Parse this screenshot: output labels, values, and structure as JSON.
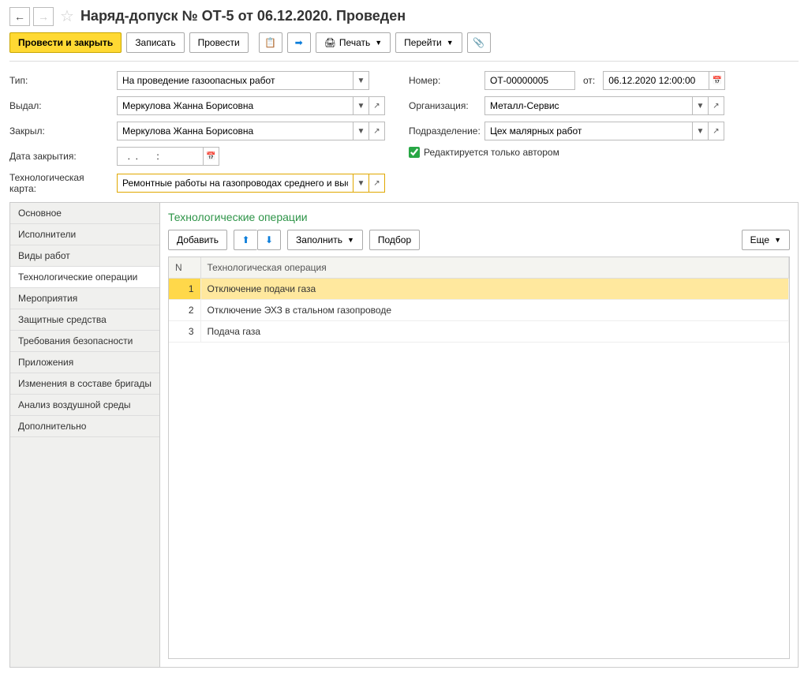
{
  "header": {
    "title": "Наряд-допуск № ОТ-5 от 06.12.2020. Проведен"
  },
  "toolbar": {
    "post_and_close": "Провести и закрыть",
    "save": "Записать",
    "post": "Провести",
    "print": "Печать",
    "goto": "Перейти"
  },
  "form": {
    "type_label": "Тип:",
    "type_value": "На проведение газоопасных работ",
    "issued_label": "Выдал:",
    "issued_value": "Меркулова Жанна Борисовна",
    "closed_label": "Закрыл:",
    "closed_value": "Меркулова Жанна Борисовна",
    "close_date_label": "Дата закрытия:",
    "close_date_value": "  .  .       :   ",
    "tech_card_label": "Технологическая карта:",
    "tech_card_value": "Ремонтные работы на газопроводах среднего и высокого да",
    "number_label": "Номер:",
    "number_value": "ОТ-00000005",
    "date_label": "от:",
    "date_value": "06.12.2020 12:00:00",
    "org_label": "Организация:",
    "org_value": "Металл-Сервис",
    "dept_label": "Подразделение:",
    "dept_value": "Цех малярных работ",
    "editable_label": "Редактируется только автором"
  },
  "sidebar": {
    "items": [
      {
        "label": "Основное"
      },
      {
        "label": "Исполнители"
      },
      {
        "label": "Виды работ"
      },
      {
        "label": "Технологические операции"
      },
      {
        "label": "Мероприятия"
      },
      {
        "label": "Защитные средства"
      },
      {
        "label": "Требования безопасности"
      },
      {
        "label": "Приложения"
      },
      {
        "label": "Изменения в составе бригады"
      },
      {
        "label": "Анализ воздушной среды"
      },
      {
        "label": "Дополнительно"
      }
    ]
  },
  "content": {
    "title": "Технологические операции",
    "add": "Добавить",
    "fill": "Заполнить",
    "pick": "Подбор",
    "more": "Еще",
    "columns": {
      "n": "N",
      "op": "Технологическая операция"
    },
    "rows": [
      {
        "n": "1",
        "op": "Отключение подачи газа"
      },
      {
        "n": "2",
        "op": "Отключение ЭХЗ в стальном газопроводе"
      },
      {
        "n": "3",
        "op": "Подача газа"
      }
    ]
  }
}
